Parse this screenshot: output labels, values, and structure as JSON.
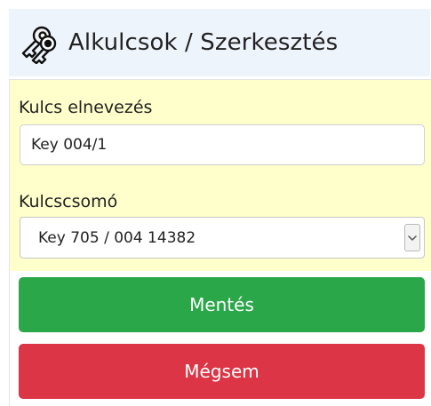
{
  "header": {
    "title": "Alkulcsok / Szerkesztés",
    "icon": "keys-icon"
  },
  "form": {
    "key_name": {
      "label": "Kulcs elnevezés",
      "value": "Key 004/1"
    },
    "key_ring": {
      "label": "Kulcscsomó",
      "selected": "Key 705 / 004 14382"
    },
    "buttons": {
      "save": "Mentés",
      "cancel": "Mégsem"
    }
  },
  "colors": {
    "header_bg": "#eef4fb",
    "form_bg": "#ffffcc",
    "save": "#2aa748",
    "cancel": "#dc3545"
  }
}
